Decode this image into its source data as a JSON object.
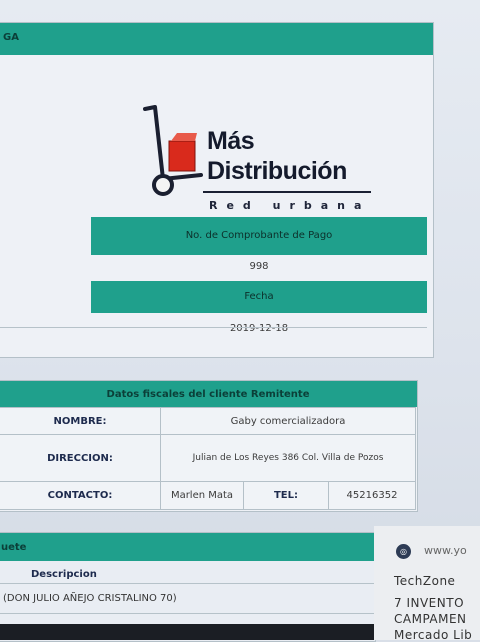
{
  "receipt": {
    "header_fragment": "GA",
    "logo": {
      "line1": "Más",
      "line2": "Distribución",
      "tagline": "Red urbana"
    },
    "comprobante_label": "No. de Comprobante de Pago",
    "comprobante_value": "998",
    "fecha_label": "Fecha",
    "fecha_value": "2019-12-18"
  },
  "fiscal": {
    "title": "Datos fiscales del cliente Remitente",
    "nombre_label": "NOMBRE:",
    "nombre_value": "Gaby comercializadora",
    "direccion_label": "DIRECCION:",
    "direccion_value": "Julian de Los Reyes 386 Col. Villa de Pozos",
    "contacto_label": "CONTACTO:",
    "contacto_value": "Marlen Mata",
    "tel_label": "TEL:",
    "tel_value": "45216352"
  },
  "package": {
    "header_fragment": "uete",
    "column_label": "Descripcion",
    "row_value": "(DON JULIO AÑEJO CRISTALINO 70)"
  },
  "overlay": {
    "url": "www.yo",
    "line1": "TechZone",
    "line2": "7 INVENTO",
    "line3": "CAMPAMEN",
    "line4": "Mercado Lib"
  },
  "colors": {
    "accent": "#1fa08c",
    "panel": "#eef1f6",
    "logo_red": "#d92a1c"
  }
}
